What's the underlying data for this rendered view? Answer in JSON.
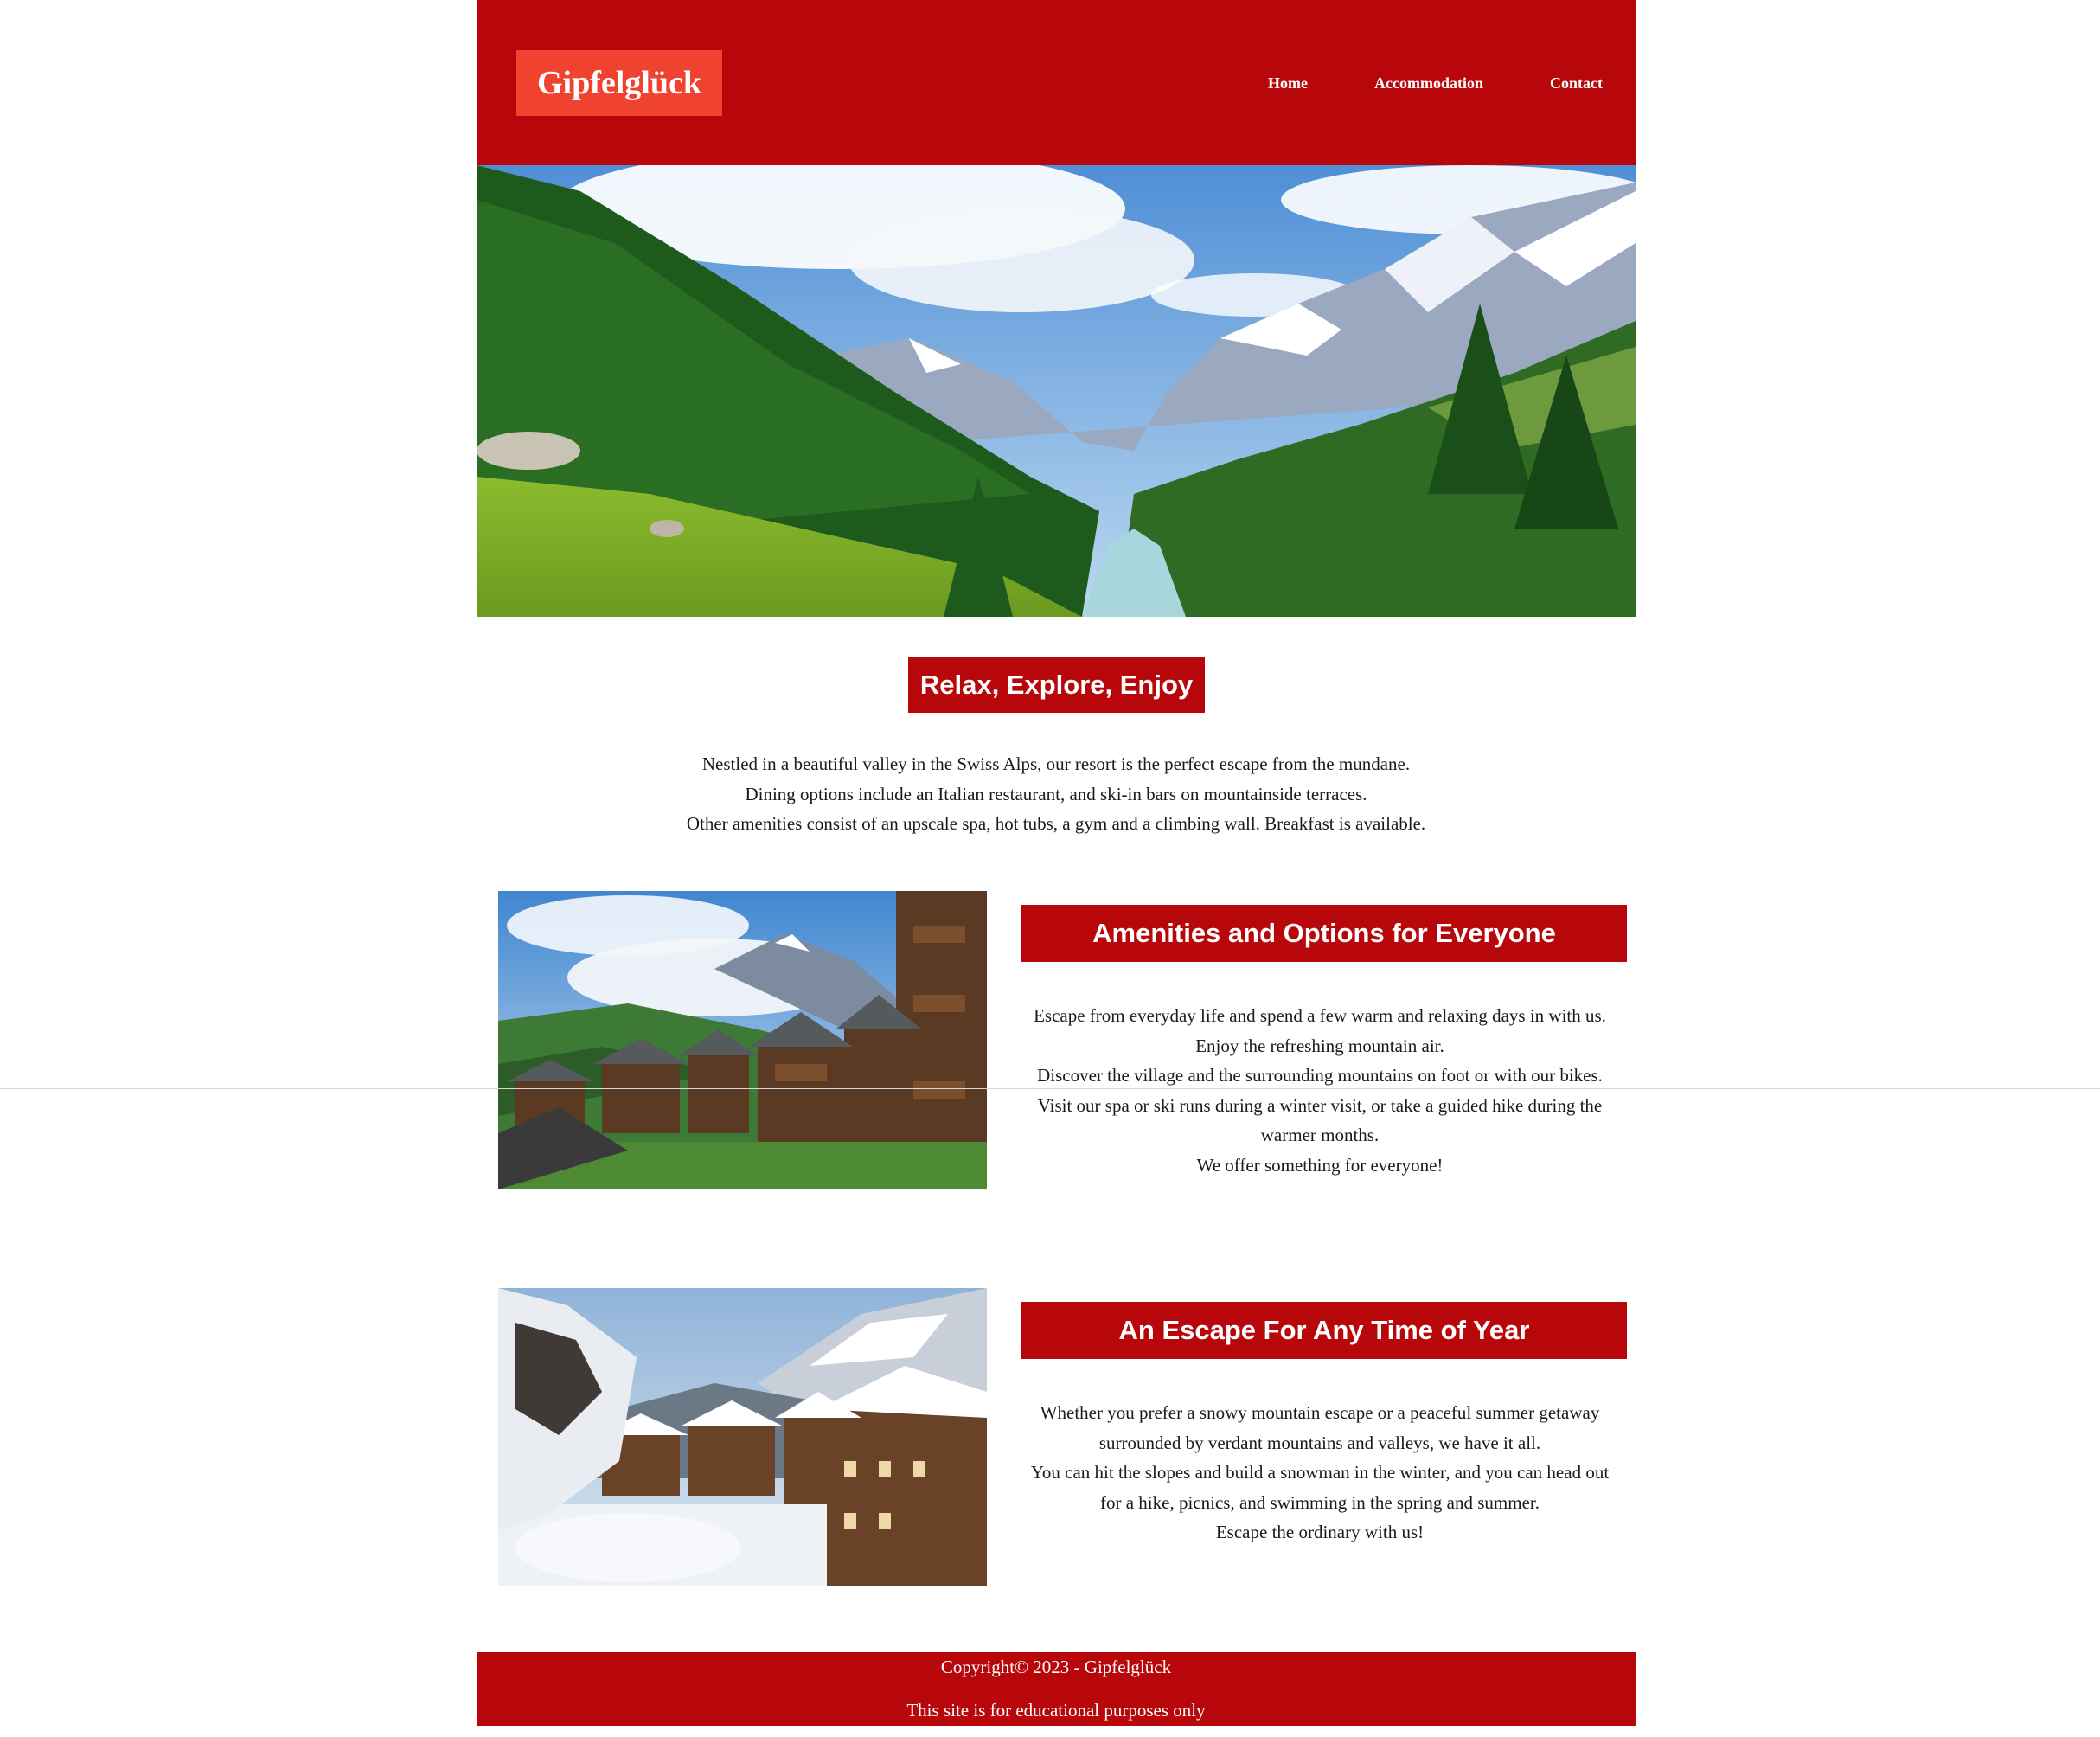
{
  "header": {
    "logo": "Gipfelglück",
    "nav": [
      "Home",
      "Accommodation",
      "Contact"
    ]
  },
  "hero": {
    "image": "alpine valley with pine forest, river and snowy peaks"
  },
  "intro": {
    "title": "Relax, Explore, Enjoy",
    "lines": [
      "Nestled in a beautiful valley in the Swiss Alps, our resort is the perfect escape from the mundane.",
      "Dining options include an Italian restaurant, and ski-in bars on mountainside terraces.",
      "Other amenities consist of an upscale spa, hot tubs, a gym and a climbing wall. Breakfast is available."
    ]
  },
  "sections": [
    {
      "image": "wooden chalet village in summer with mountains and clouds",
      "title": "Amenities and Options for Everyone",
      "lines": [
        "Escape from everyday life and spend a few warm and relaxing days in with us.",
        "Enjoy the refreshing mountain air.",
        "Discover the village and the surrounding mountains on foot or with our bikes.",
        "Visit our spa or ski runs during a winter visit, or take a guided hike during the warmer months.",
        "We offer something for everyone!"
      ]
    },
    {
      "image": "snow-covered wooden chalet village in winter",
      "title": "An Escape For Any Time of Year",
      "lines": [
        "Whether you prefer a snowy mountain escape or a peaceful summer getaway surrounded by verdant mountains and valleys, we have it all.",
        "You can hit the slopes and build a snowman in the winter, and you can head out for a hike, picnics, and swimming in the spring and summer.",
        "Escape the ordinary with us!"
      ]
    }
  ],
  "footer": {
    "copyright": "Copyright© 2023 - Gipfelglück",
    "note": "This site is for educational purposes only"
  },
  "colors": {
    "brand_red": "#b8070b",
    "logo_bg": "#f0432f"
  }
}
